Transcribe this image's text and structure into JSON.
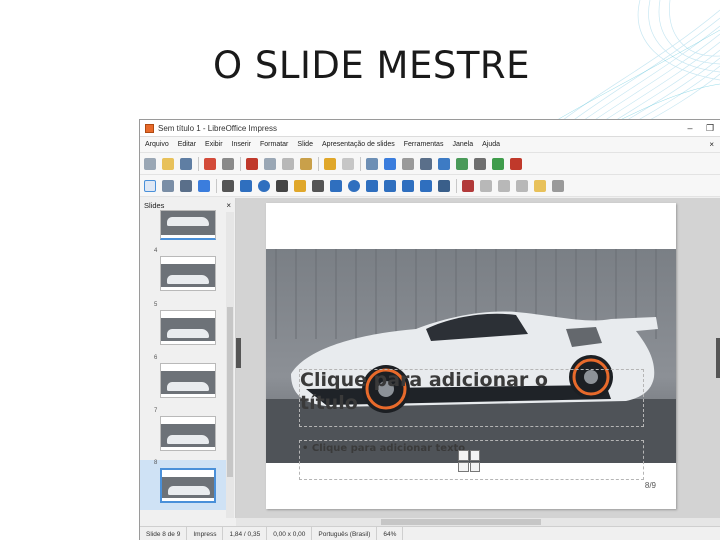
{
  "slide_title": "O SLIDE MESTRE",
  "window": {
    "title": "Sem título 1 - LibreOffice Impress",
    "controls": [
      "–",
      "❐"
    ]
  },
  "menu": [
    "Arquivo",
    "Editar",
    "Exibir",
    "Inserir",
    "Formatar",
    "Slide",
    "Apresentação de slides",
    "Ferramentas",
    "Janela",
    "Ajuda"
  ],
  "menu_close": "×",
  "slides_panel": {
    "heading": "Slides",
    "close": "×",
    "thumbs": [
      {
        "num": "",
        "selected": false
      },
      {
        "num": "4",
        "selected": false
      },
      {
        "num": "5",
        "selected": false
      },
      {
        "num": "6",
        "selected": false
      },
      {
        "num": "7",
        "selected": false
      },
      {
        "num": "8",
        "selected": true
      }
    ]
  },
  "slide": {
    "title_placeholder": "Clique para adicionar o título",
    "content_placeholder": "• Clique para adicionar texto",
    "number": "8/9"
  },
  "statusbar": {
    "slide_info": "Slide 8 de 9",
    "layout": "Impress",
    "position": "1,84 / 0,35",
    "size": "0,00 x 0,00",
    "language": "Português (Brasil)",
    "zoom": "64%"
  },
  "colors": {
    "selection": "#4a90d9",
    "accent_orange": "#e86a2b"
  }
}
